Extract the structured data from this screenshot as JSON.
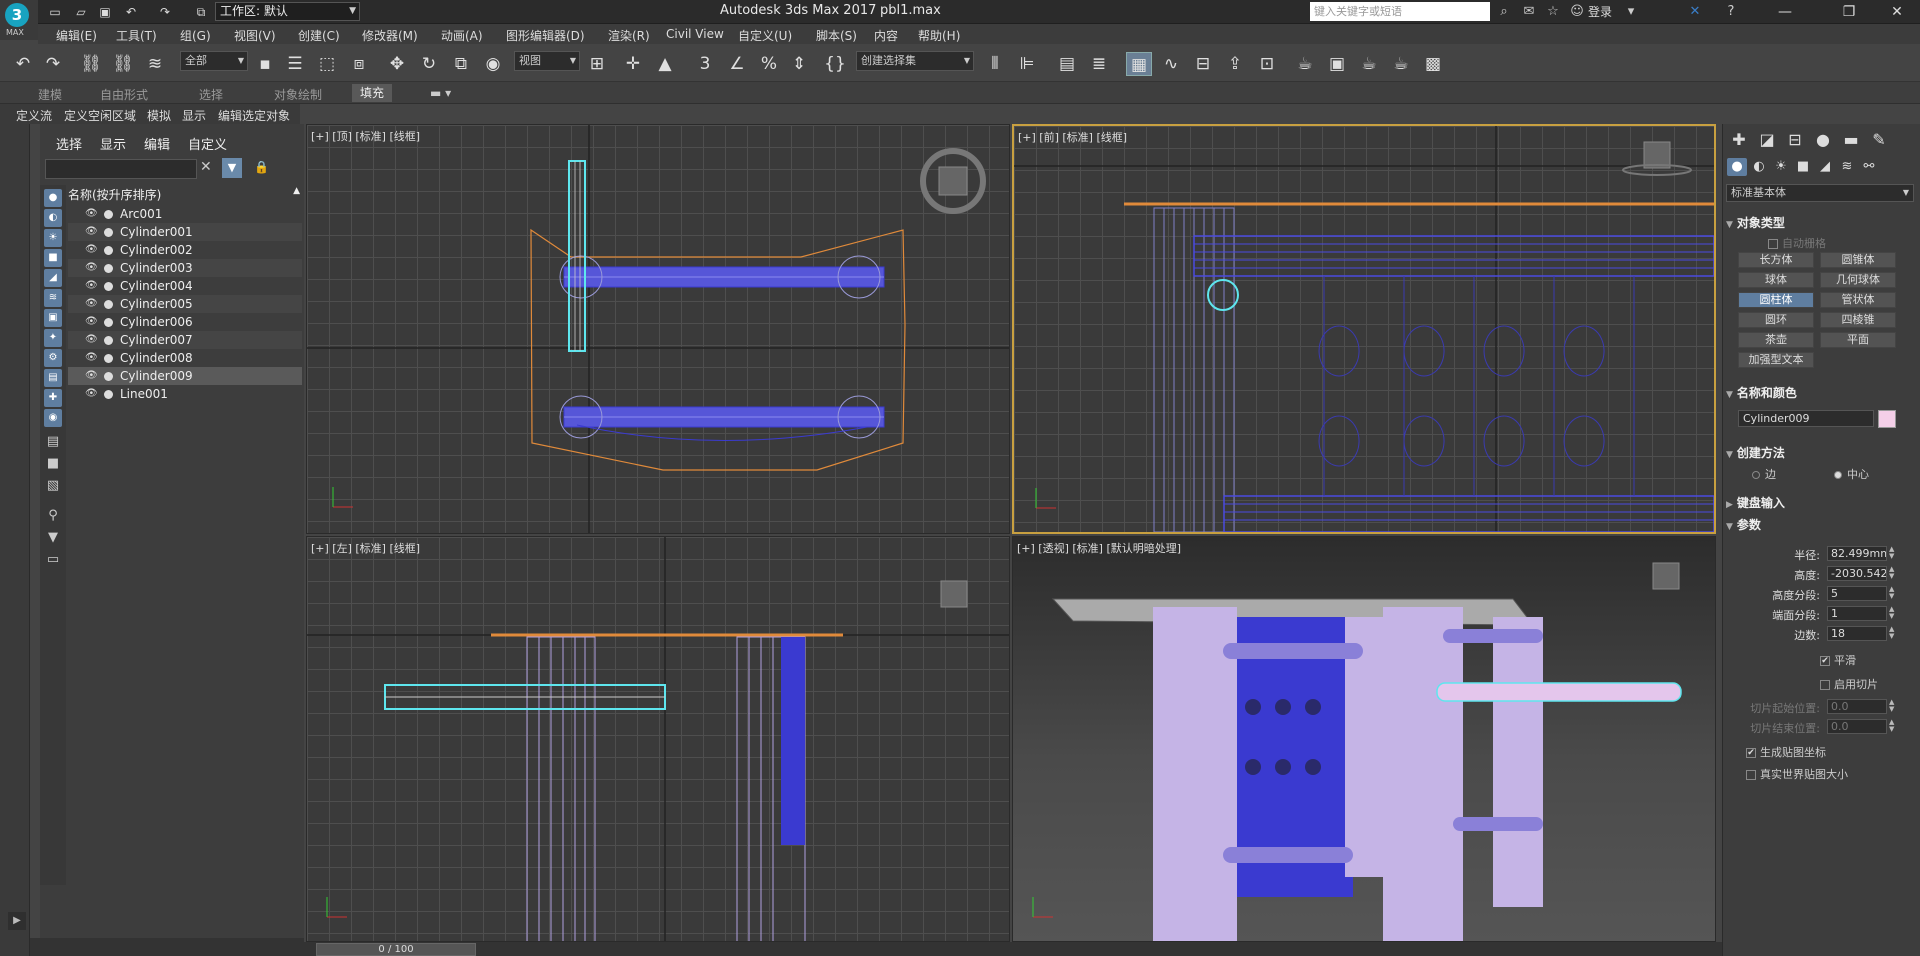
{
  "titlebar": {
    "app_title": "Autodesk 3ds Max 2017",
    "file_name": "pbl1.max",
    "logo_text": "MAX",
    "workspace": "工作区: 默认",
    "search_placeholder": "键入关键字或短语",
    "login": "登录"
  },
  "menu": [
    "编辑(E)",
    "工具(T)",
    "组(G)",
    "视图(V)",
    "创建(C)",
    "修改器(M)",
    "动画(A)",
    "图形编辑器(D)",
    "渲染(R)",
    "Civil View",
    "自定义(U)",
    "脚本(S)",
    "内容",
    "帮助(H)"
  ],
  "toolbar": {
    "selection_filter": "全部",
    "ref_coord": "视图",
    "named_selection": "创建选择集"
  },
  "ribbon": {
    "tabs": [
      "建模",
      "自由形式",
      "选择",
      "对象绘制",
      "填充"
    ],
    "active_tab": "填充",
    "subitems": [
      "定义流",
      "定义空闲区域",
      "模拟",
      "显示",
      "编辑选定对象"
    ]
  },
  "scene_explorer": {
    "menus": [
      "选择",
      "显示",
      "编辑",
      "自定义"
    ],
    "column_header": "名称(按升序排序)",
    "items": [
      {
        "name": "Arc001"
      },
      {
        "name": "Cylinder001"
      },
      {
        "name": "Cylinder002"
      },
      {
        "name": "Cylinder003"
      },
      {
        "name": "Cylinder004"
      },
      {
        "name": "Cylinder005"
      },
      {
        "name": "Cylinder006"
      },
      {
        "name": "Cylinder007"
      },
      {
        "name": "Cylinder008"
      },
      {
        "name": "Cylinder009"
      },
      {
        "name": "Line001"
      }
    ],
    "selected": "Cylinder009"
  },
  "viewports": [
    {
      "label": "[+] [顶] [标准] [线框]"
    },
    {
      "label": "[+] [前] [标准] [线框]"
    },
    {
      "label": "[+] [左] [标准] [线框]"
    },
    {
      "label": "[+] [透视] [标准] [默认明暗处理]"
    }
  ],
  "command_panel": {
    "category": "标准基本体",
    "object_type_title": "对象类型",
    "auto_grid": "自动栅格",
    "object_types": [
      "长方体",
      "圆锥体",
      "球体",
      "几何球体",
      "圆柱体",
      "管状体",
      "圆环",
      "四棱锥",
      "茶壶",
      "平面",
      "加强型文本"
    ],
    "active_object_type": "圆柱体",
    "name_color_title": "名称和颜色",
    "object_name": "Cylinder009",
    "object_color": "#f4cfe8",
    "creation_method_title": "创建方法",
    "creation_methods": [
      "边",
      "中心"
    ],
    "active_creation_method": "中心",
    "keyboard_entry_title": "键盘输入",
    "params_title": "参数",
    "params": [
      {
        "label": "半径:",
        "value": "82.499mm"
      },
      {
        "label": "高度:",
        "value": "-2030.542"
      },
      {
        "label": "高度分段:",
        "value": "5"
      },
      {
        "label": "端面分段:",
        "value": "1"
      },
      {
        "label": "边数:",
        "value": "18"
      }
    ],
    "smooth": "平滑",
    "enable_slice": "启用切片",
    "slice_from": {
      "label": "切片起始位置:",
      "value": "0.0"
    },
    "slice_to": {
      "label": "切片结束位置:",
      "value": "0.0"
    },
    "gen_mapping": "生成贴图坐标",
    "real_world_map": "真实世界贴图大小"
  },
  "timeline": {
    "frame": "0 / 100"
  }
}
